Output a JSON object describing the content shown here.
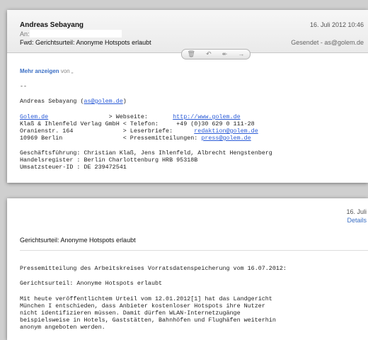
{
  "mail1": {
    "sender": "Andreas Sebayang",
    "date": "16. Juli 2012 10:46",
    "to_label": "An:",
    "subject": "Fwd: Gerichtsurteil: Anonyme Hotspots erlaubt",
    "sent_from": "Gesendet - as@golem.de",
    "toolbar": {
      "trash": "🗑",
      "reply": "↶",
      "reply_all": "↞",
      "forward": "→"
    },
    "more_link": "Mehr anzeigen",
    "more_from": "von „",
    "signature": {
      "dashes": "--",
      "name_prefix": "Andreas Sebayang (",
      "name_email": "as@golem.de",
      "name_suffix": ")",
      "company_link": "Golem.de",
      "company_pad": "                 ",
      "web_label": "> Webseite:       ",
      "web_url": "http://www.golem.de",
      "line2": "Klaß & Ihlenfeld Verlag GmbH < Telefon:     +49 (0)30 629 0 111-28",
      "line3_left": "Oranienstr. 164              > Leserbriefe:      ",
      "line3_mail": "redaktion@golem.de",
      "line4_left": "10969 Berlin                 < Pressemitteilungen: ",
      "line4_mail": "press@golem.de",
      "gf": "Geschäftsführung: Christian Klaß, Jens Ihlenfeld, Albrecht Hengstenberg",
      "hr": "Handelsregister : Berlin Charlottenburg HRB 95318B",
      "ust": "Umsatzsteuer-ID : DE 239472541"
    }
  },
  "mail2": {
    "date": "16. Juli",
    "details": "Details",
    "subject": "Gerichtsurteil: Anonyme Hotspots erlaubt",
    "body": {
      "intro": "Pressemitteilung des Arbeitskreises Vorratsdatenspeicherung vom 16.07.2012:",
      "title": "Gerichtsurteil: Anonyme Hotspots erlaubt",
      "p1": "Mit heute veröffentlichtem Urteil vom 12.01.2012[1] hat das Landgericht\nMünchen I entschieden, dass Anbieter kostenloser Hotspots ihre Nutzer\nnicht identifizieren müssen. Damit dürfen WLAN-Internetzugänge\nbeispielsweise in Hotels, Gaststätten, Bahnhöfen und Flughäfen weiterhin\nanonym angeboten werden."
    }
  }
}
